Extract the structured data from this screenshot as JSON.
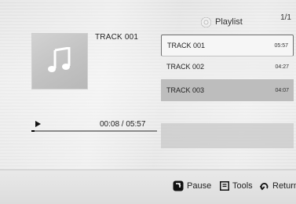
{
  "playlist_header": {
    "icon": "disc-icon",
    "title": "Playlist",
    "page": "1/1"
  },
  "now_playing": {
    "title": "TRACK 001",
    "time": "00:08 / 05:57",
    "progress": 0.022,
    "art_icon": "music-note-icon"
  },
  "tracks": [
    {
      "name": "TRACK 001",
      "duration": "05:57",
      "state": "selected"
    },
    {
      "name": "TRACK 002",
      "duration": "04:27",
      "state": "normal"
    },
    {
      "name": "TRACK 003",
      "duration": "04:07",
      "state": "playing"
    }
  ],
  "controls": {
    "pause": {
      "icon": "pause-key-icon",
      "label": "Pause"
    },
    "tools": {
      "icon": "tools-icon",
      "label": "Tools"
    },
    "return": {
      "icon": "return-icon",
      "label": "Return"
    }
  }
}
